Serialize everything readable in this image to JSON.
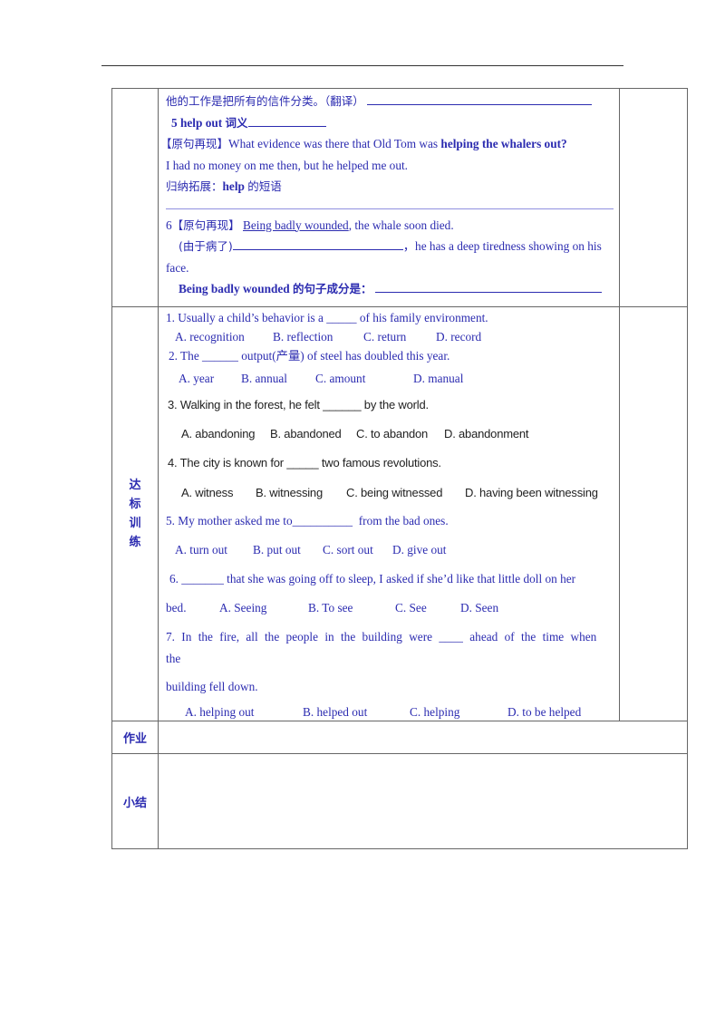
{
  "row1": {
    "translate_prompt": "他的工作是把所有的信件分类。（翻译）",
    "item5_number": "5",
    "item5_phrase": "help out",
    "item5_suffix": "词义",
    "original_bracket": "【原句再现】",
    "original_text": "What evidence was there that Old Tom was ",
    "original_bold": "helping the whalers out?",
    "example_sentence": "I had no money on me then, but he helped me out.",
    "summary_prefix": "归纳拓展：",
    "summary_bold": "help",
    "summary_suffix": "的短语",
    "item6_number": "6",
    "item6_bracket": "【原句再现】",
    "item6_underlined": "Being badly wounded",
    "item6_rest": ", the whale soon died.",
    "item6_fill_prefix": "(由于病了)",
    "item6_fill_suffix": "，he has a deep tiredness showing on his",
    "item6_fill_cont": "face.",
    "item6_component_bold": "Being badly wounded",
    "item6_component_suffix": "的句子成分是："
  },
  "practice": {
    "label_chars": [
      "达",
      "标",
      "训",
      "练"
    ],
    "questions": [
      {
        "stem": "1. Usually a child’s behavior is a _____ of his family environment.",
        "options": [
          "A. recognition",
          "B. reflection",
          "C. return",
          "D. record"
        ]
      },
      {
        "stem": "2. The ______ output(产量) of steel has doubled this year.",
        "options": [
          "A. year",
          "B. annual",
          "C. amount",
          "D. manual"
        ]
      },
      {
        "stem": "3. Walking in the forest, he felt ______ by the world.",
        "options": [
          "A. abandoning",
          "B. abandoned",
          "C. to abandon",
          "D. abandonment"
        ]
      },
      {
        "stem": "4. The city is known for _____ two  famous revolutions.",
        "options": [
          "A. witness",
          "B. witnessing",
          "C. being witnessed",
          "D. having been witnessing"
        ]
      },
      {
        "stem": "5. My mother asked me to__________  from the bad ones.",
        "options": [
          "A. turn out",
          "B. put out",
          "C. sort out",
          "D. give out"
        ]
      },
      {
        "stem": "6. _______ that she was going off to sleep, I asked if she’d like that little doll on her",
        "stem_cont": "bed.",
        "options": [
          "A. Seeing",
          "B. To see",
          "C. See",
          "D. Seen"
        ]
      },
      {
        "stem": "7. In the fire, all the people in the building were ____ ahead of the time when the",
        "stem_cont": "building fell down.",
        "options": [
          "A. helping out",
          "B. helped out",
          "C. helping",
          "D. to be helped"
        ]
      }
    ]
  },
  "homework": {
    "label": "作业",
    "content": ""
  },
  "summary": {
    "label": "小结",
    "content": ""
  }
}
